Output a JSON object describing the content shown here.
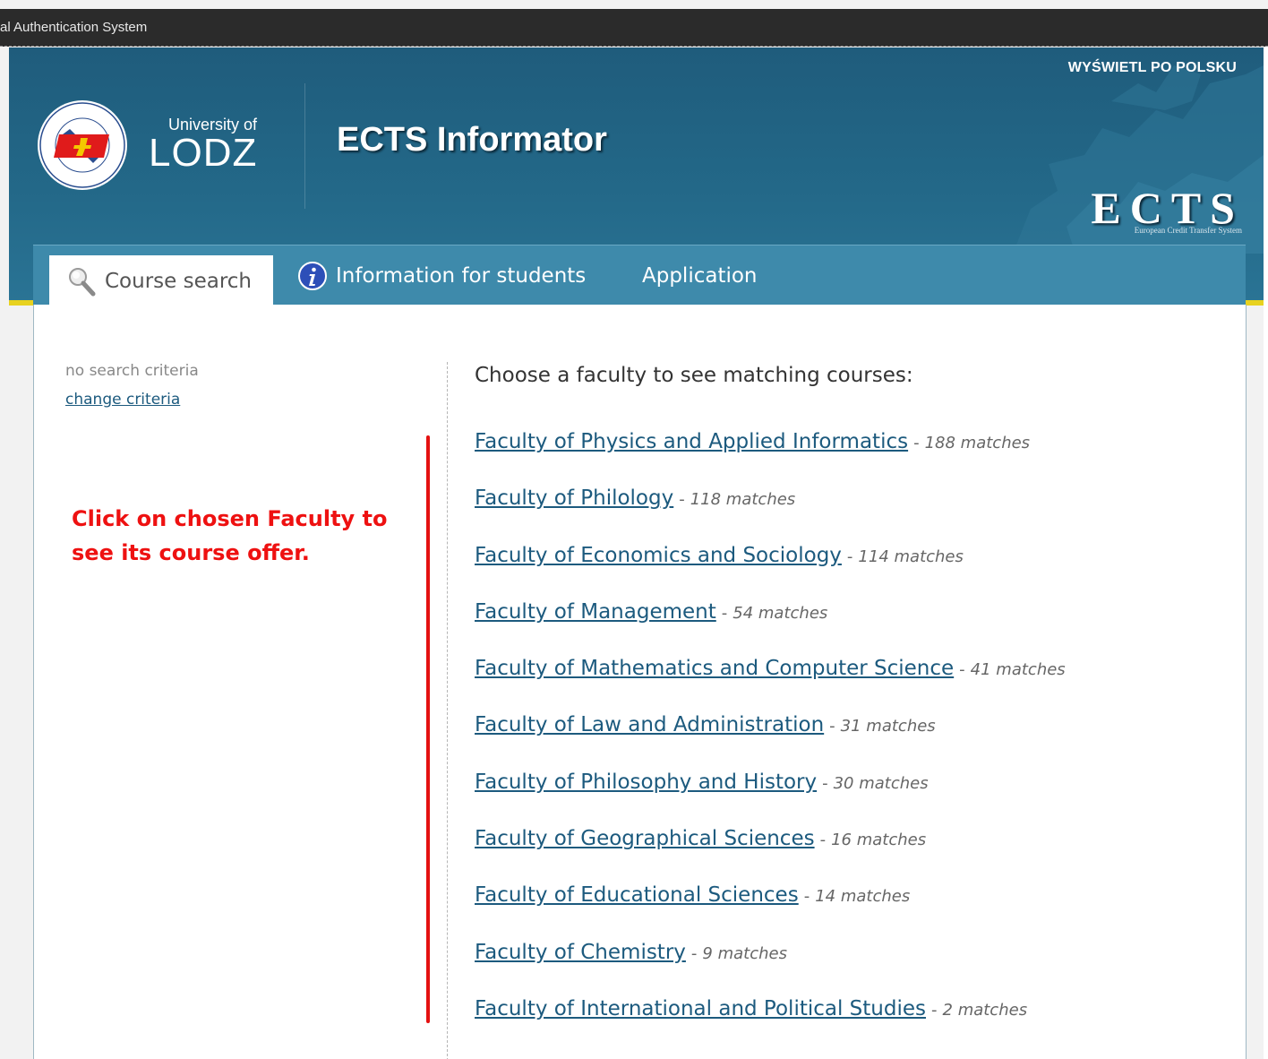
{
  "window": {
    "title": "al Authentication System"
  },
  "header": {
    "lang_link": "WYŚWIETL PO POLSKU",
    "university_of": "University of",
    "university_name": "LODZ",
    "app_title": "ECTS Informator",
    "ects_logo": "ECTS",
    "ects_subtitle": "European Credit Transfer System"
  },
  "nav": {
    "tabs": [
      {
        "label": "Course search",
        "icon": "search-icon",
        "active": true
      },
      {
        "label": "Information for students",
        "icon": "info-icon",
        "active": false
      },
      {
        "label": "Application",
        "icon": "",
        "active": false
      }
    ]
  },
  "sidebar": {
    "criteria_note": "no search criteria",
    "change_link": "change criteria",
    "instruction": "Click on chosen Faculty to see its course offer."
  },
  "main": {
    "prompt": "Choose a faculty to see matching courses:",
    "separator": "-",
    "faculties": [
      {
        "name": "Faculty of Physics and Applied Informatics",
        "count": "188 matches"
      },
      {
        "name": "Faculty of Philology",
        "count": "118 matches"
      },
      {
        "name": "Faculty of Economics and Sociology",
        "count": "114 matches"
      },
      {
        "name": "Faculty of Management",
        "count": "54 matches"
      },
      {
        "name": "Faculty of Mathematics and Computer Science",
        "count": "41 matches"
      },
      {
        "name": "Faculty of Law and Administration",
        "count": "31 matches"
      },
      {
        "name": "Faculty of Philosophy and History",
        "count": "30 matches"
      },
      {
        "name": "Faculty of Geographical Sciences",
        "count": "16 matches"
      },
      {
        "name": "Faculty of Educational Sciences",
        "count": "14 matches"
      },
      {
        "name": "Faculty of Chemistry",
        "count": "9 matches"
      },
      {
        "name": "Faculty of International and Political Studies",
        "count": "2 matches"
      }
    ]
  },
  "colors": {
    "header_bg": "#236888",
    "nav_bg": "#3e8aab",
    "link": "#1c5a7e",
    "instruction_red": "#ee1111",
    "accent_yellow": "#e8d21f"
  }
}
